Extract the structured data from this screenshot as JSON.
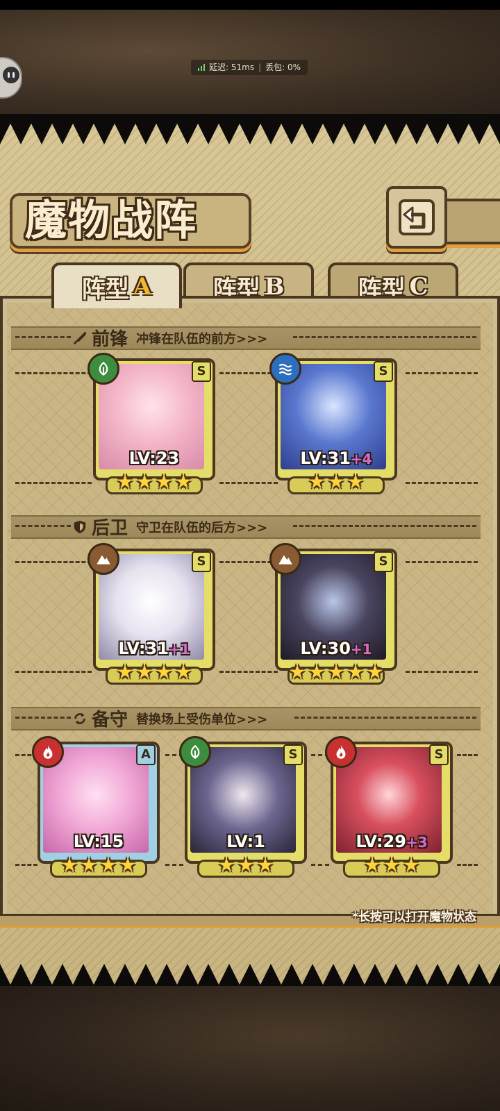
{
  "status": {
    "latency_label": "延迟: 51ms",
    "loss_label": "丢包: 0%"
  },
  "title": "魔物战阵",
  "tabs": [
    {
      "label": "阵型",
      "letter": "A",
      "active": true
    },
    {
      "label": "阵型",
      "letter": "B",
      "active": false
    },
    {
      "label": "阵型",
      "letter": "C",
      "active": false
    }
  ],
  "sections": [
    {
      "name": "前锋",
      "desc": "冲锋在队伍的前方>>>",
      "icon": "sword-icon",
      "cards": [
        {
          "element": "wood",
          "rank": "S",
          "level": "LV:23",
          "plus": "",
          "stars": 4
        },
        {
          "element": "water",
          "rank": "S",
          "level": "LV:31",
          "plus": "+4",
          "stars": 3
        }
      ]
    },
    {
      "name": "后卫",
      "desc": "守卫在队伍的后方>>>",
      "icon": "shield-icon",
      "cards": [
        {
          "element": "earth",
          "rank": "S",
          "level": "LV:31",
          "plus": "+1",
          "stars": 4
        },
        {
          "element": "earth",
          "rank": "S",
          "level": "LV:30",
          "plus": "+1",
          "stars": 5
        }
      ]
    },
    {
      "name": "备守",
      "desc": "替换场上受伤单位>>>",
      "icon": "swap-icon",
      "cards": [
        {
          "element": "fire",
          "rank": "A",
          "level": "LV:15",
          "plus": "",
          "stars": 4
        },
        {
          "element": "wood",
          "rank": "S",
          "level": "LV:1",
          "plus": "",
          "stars": 3
        },
        {
          "element": "fire",
          "rank": "S",
          "level": "LV:29",
          "plus": "+3",
          "stars": 3
        }
      ]
    }
  ],
  "hint": "*长按可以打开魔物状态",
  "colors": {
    "gold_frame": "#e4dd68",
    "blue_frame": "#9fd0e4",
    "accent": "#f2b634",
    "plus": "#d86ad0"
  }
}
